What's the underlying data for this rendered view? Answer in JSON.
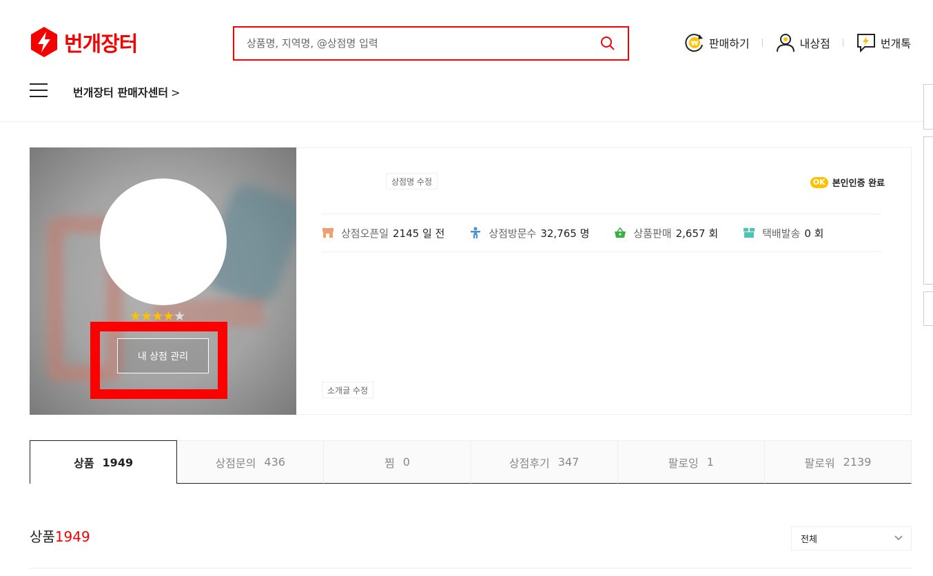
{
  "header": {
    "logo_text": "번개장터",
    "search_placeholder": "상품명, 지역명, @상점명 입력",
    "menu": {
      "sell": "판매하기",
      "my_shop": "내상점",
      "talk": "번개톡"
    },
    "seller_center": "번개장터 판매자센터",
    "seller_center_chevron": ">"
  },
  "profile": {
    "stars": "★★★★",
    "half_star": "★",
    "manage_button": "내 상점 관리"
  },
  "info": {
    "edit_name_button": "상점명 수정",
    "verified_badge": "OK",
    "verified_text": "본인인증 완료",
    "stats": [
      {
        "label": "상점오픈일",
        "value": "2145 일 전"
      },
      {
        "label": "상점방문수",
        "value": "32,765 명"
      },
      {
        "label": "상품판매",
        "value": "2,657 회"
      },
      {
        "label": "택배발송",
        "value": "0 회"
      }
    ],
    "edit_intro_button": "소개글 수정"
  },
  "tabs": [
    {
      "label": "상품",
      "count": "1949"
    },
    {
      "label": "상점문의",
      "count": "436"
    },
    {
      "label": "찜",
      "count": "0"
    },
    {
      "label": "상점후기",
      "count": "347"
    },
    {
      "label": "팔로잉",
      "count": "1"
    },
    {
      "label": "팔로워",
      "count": "2139"
    }
  ],
  "section": {
    "title": "상품",
    "count": "1949"
  },
  "filter": {
    "selected": "전체"
  },
  "colors": {
    "brand": "#f70000",
    "star": "#ffc000",
    "ok_badge": "#ffc000"
  }
}
